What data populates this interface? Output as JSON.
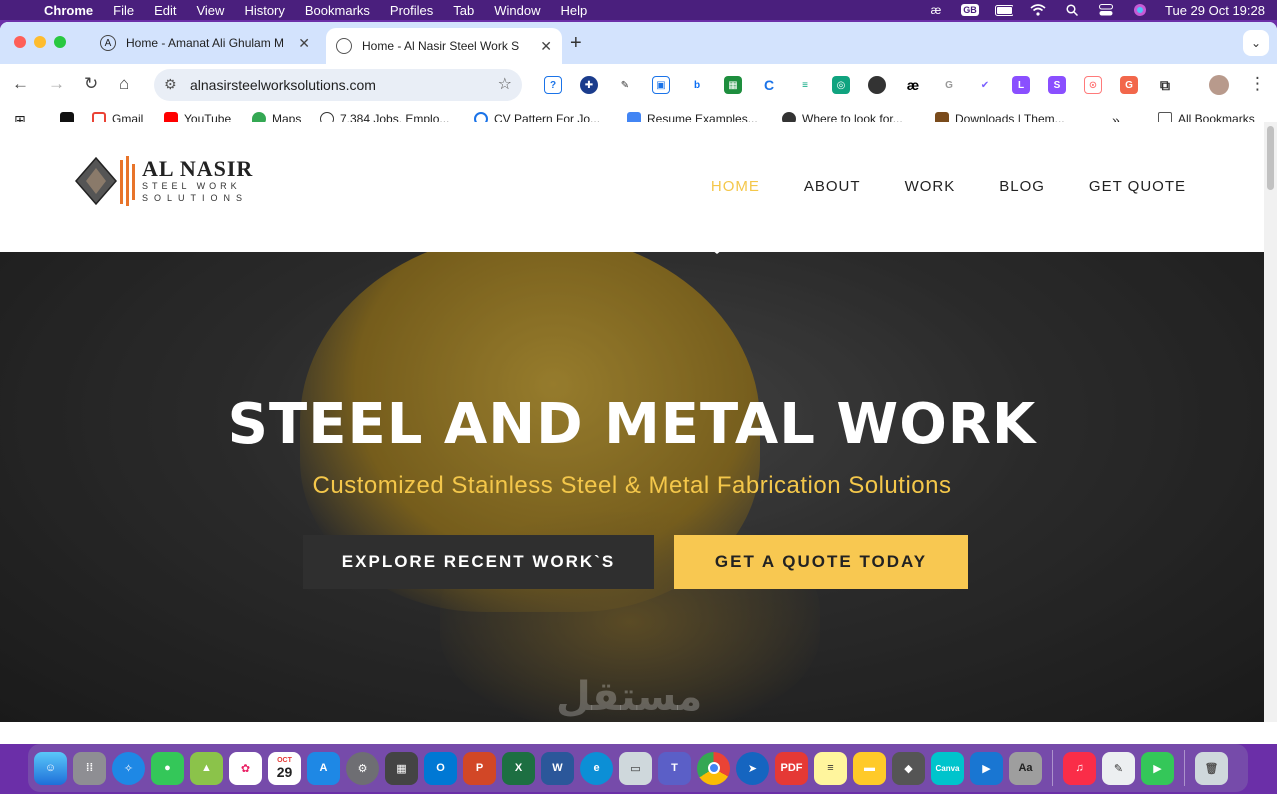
{
  "menubar": {
    "app_name": "Chrome",
    "items": [
      "File",
      "Edit",
      "View",
      "History",
      "Bookmarks",
      "Profiles",
      "Tab",
      "Window",
      "Help"
    ],
    "clock": "Tue 29 Oct  19:28",
    "status_text": "GB"
  },
  "tabs": [
    {
      "title": "Home - Amanat Ali Ghulam M",
      "active": false
    },
    {
      "title": "Home - Al Nasir Steel Work S",
      "active": true
    }
  ],
  "toolbar": {
    "url": "alnasirsteelworksolutions.com"
  },
  "bookmarks": [
    {
      "label": "",
      "icon": "amazon-icon"
    },
    {
      "label": "Gmail",
      "icon": "gmail-icon"
    },
    {
      "label": "YouTube",
      "icon": "youtube-icon"
    },
    {
      "label": "Maps",
      "icon": "maps-icon"
    },
    {
      "label": "7,384 Jobs, Emplo...",
      "icon": "info-icon"
    },
    {
      "label": "CV Pattern For Jo...",
      "icon": "cv-icon"
    },
    {
      "label": "Resume Examples...",
      "icon": "doc-icon"
    },
    {
      "label": "Where to look for...",
      "icon": "globe-icon"
    },
    {
      "label": "Downloads | Them...",
      "icon": "downloads-icon"
    }
  ],
  "all_bookmarks": "All Bookmarks",
  "site": {
    "logo": {
      "line1": "AL NASIR",
      "line2": "STEEL WORK",
      "line3": "SOLUTIONS"
    },
    "nav": [
      "HOME",
      "ABOUT",
      "WORK",
      "BLOG",
      "GET QUOTE"
    ],
    "active_nav": "HOME",
    "hero": {
      "title": "STEEL AND METAL WORK",
      "subtitle": "Customized Stainless Steel & Metal Fabrication Solutions",
      "primary_button": "EXPLORE RECENT WORK`S",
      "secondary_button": "GET A QUOTE TODAY"
    },
    "watermark": "مستقل"
  },
  "colors": {
    "accent": "#f4c74a",
    "button_gold": "#f8c851",
    "button_dark": "#2f2f2f"
  },
  "dock": {
    "calendar_month": "OCT",
    "calendar_day": "29"
  }
}
